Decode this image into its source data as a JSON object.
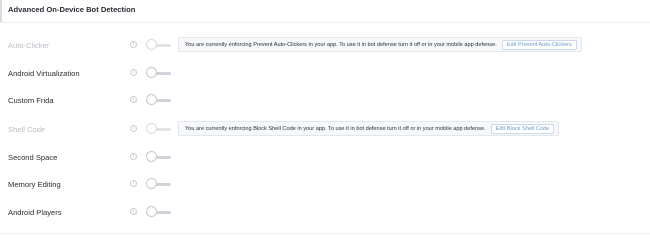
{
  "section": {
    "title": "Advanced On-Device Bot Detection"
  },
  "rows": [
    {
      "label": "Auto-Clicker",
      "disabled": true,
      "toggle_on": false,
      "notice": "You are currently enforcing Prevent Auto-Clickers in your app. To use it in bot defense turn it off or in your mobile app defense.",
      "notice_button": "Edit Prevent Auto-Clickers"
    },
    {
      "label": "Android Virtualization",
      "disabled": false,
      "toggle_on": false
    },
    {
      "label": "Custom Frida",
      "disabled": false,
      "toggle_on": false
    },
    {
      "label": "Shell Code",
      "disabled": true,
      "toggle_on": false,
      "notice": "You are currently enforcing Block Shell Code in your app. To use it in bot defense turn it off or in your mobile app defense.",
      "notice_button": "Edit Block Shell Code"
    },
    {
      "label": "Second Space",
      "disabled": false,
      "toggle_on": false
    },
    {
      "label": "Memory Editing",
      "disabled": false,
      "toggle_on": false
    },
    {
      "label": "Android Players",
      "disabled": false,
      "toggle_on": false
    }
  ],
  "info_icon": "info-icon",
  "colors": {
    "text": "#2a2f36",
    "disabled_text": "#b9bec5",
    "link": "#6b9ac6"
  }
}
